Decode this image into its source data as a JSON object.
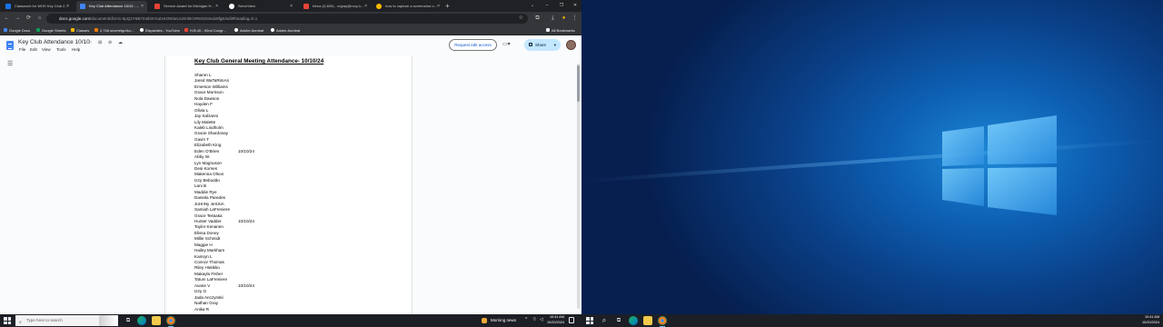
{
  "browser": {
    "tabs": [
      {
        "title": "Classwork for WHS Key Club 2...",
        "favicon_color": "#1a73e8",
        "active": false
      },
      {
        "title": "Key Club Attendance 10/10 - ...",
        "favicon_color": "#4285f4",
        "active": true
      },
      {
        "title": "Service Award for Michigan H...",
        "favicon_color": "#ea4335",
        "active": false
      },
      {
        "title": "ServeView",
        "favicon_color": "#ffffff",
        "active": false
      },
      {
        "title": "Inbox (5,609) - mgray@rocp.k...",
        "favicon_color": "#ea4335",
        "active": false
      },
      {
        "title": "how to capture a screenshot o...",
        "favicon_color": "#fbbc04",
        "active": false
      }
    ],
    "new_tab_glyph": "+",
    "window_controls": [
      "⌄",
      "–",
      "❐",
      "✕"
    ],
    "nav_glyphs": {
      "back": "←",
      "forward": "→",
      "reload": "⟳",
      "site_info": "⚙"
    },
    "url": "docs.google.com",
    "url_rest": "/document/d/1H1-5pQ4Y6B7mebmYuZxKON0eUUOnkKVRK81Nmdx8fgE/edit#heading=h.1",
    "toolbar_icons": [
      "star-icon",
      "extensions-icon",
      "download-icon",
      "profile-icon",
      "menu-icon"
    ],
    "bookmarks": [
      {
        "label": "Google Docs",
        "color": "#4285f4"
      },
      {
        "label": "Google Sheets",
        "color": "#0f9d58"
      },
      {
        "label": "Classes",
        "color": "#fbbc04"
      },
      {
        "label": "2,746 sovereign/ku...",
        "color": "#f57c00"
      },
      {
        "label": "Elsparales - YouTube",
        "color": "#ffffff"
      },
      {
        "label": "H.B.40 - 92nd Congr...",
        "color": "#ea4335"
      },
      {
        "label": "Adobe Acrobat",
        "color": "#ffffff"
      },
      {
        "label": "Adobe Acrobat",
        "color": "#ffffff"
      }
    ],
    "all_bookmarks": "All Bookmarks"
  },
  "doc": {
    "title": "Key Club Attendance 10/10",
    "menu": [
      "File",
      "Edit",
      "View",
      "Tools",
      "Help"
    ],
    "request_edit_label": "Request edit access",
    "share_label": "Share",
    "heading": "Key Club General Meeting Attendance- 10/10/24",
    "attendees": [
      {
        "name": "Sharon L",
        "date": ""
      },
      {
        "name": "Jared WaTaRimAn",
        "date": ""
      },
      {
        "name": "Emerson Williams",
        "date": ""
      },
      {
        "name": "Grace Morrison",
        "date": ""
      },
      {
        "name": "Nola Dawson",
        "date": ""
      },
      {
        "name": "Hayden F",
        "date": ""
      },
      {
        "name": "Olivia L",
        "date": ""
      },
      {
        "name": "Jay Salzanni",
        "date": ""
      },
      {
        "name": "Lily Malette",
        "date": ""
      },
      {
        "name": "Kaleb Lindholm",
        "date": ""
      },
      {
        "name": "Gracie Shardonay",
        "date": ""
      },
      {
        "name": "Gavin T",
        "date": ""
      },
      {
        "name": "Elizabeth King",
        "date": ""
      },
      {
        "name": "Eden O'Brien",
        "date": "10/10/24"
      },
      {
        "name": "Abby W.",
        "date": ""
      },
      {
        "name": "Lyn Magnuson",
        "date": ""
      },
      {
        "name": "Desi Kornes",
        "date": ""
      },
      {
        "name": "Makenna Olson",
        "date": ""
      },
      {
        "name": "Izzy Beboddo",
        "date": ""
      },
      {
        "name": "Lani B",
        "date": ""
      },
      {
        "name": "Maddie Rye",
        "date": ""
      },
      {
        "name": "Daniela Paredes",
        "date": ""
      },
      {
        "name": "JoHnNy JeSSiA",
        "date": ""
      },
      {
        "name": "Samiah LaFreniere",
        "date": ""
      },
      {
        "name": "Grace Tessaka",
        "date": ""
      },
      {
        "name": "Hunter Vadder",
        "date": "10/10/24"
      },
      {
        "name": "Taylor Kenanen",
        "date": ""
      },
      {
        "name": "Elissa Doney",
        "date": ""
      },
      {
        "name": "Millie Schmidt",
        "date": ""
      },
      {
        "name": "Maggie H",
        "date": ""
      },
      {
        "name": "Hailey Markham",
        "date": ""
      },
      {
        "name": "Kamryn L",
        "date": ""
      },
      {
        "name": "Connor Thomas",
        "date": ""
      },
      {
        "name": "Riley Hietikko",
        "date": ""
      },
      {
        "name": "Makayla Fisher",
        "date": ""
      },
      {
        "name": "Tatum LaFreniere",
        "date": ""
      },
      {
        "name": "Avarie V",
        "date": "10/10/24"
      },
      {
        "name": "Izzy G",
        "date": ""
      },
      {
        "name": "Jada Anczynski",
        "date": ""
      },
      {
        "name": "Nathan Gray",
        "date": ""
      },
      {
        "name": "Anika R",
        "date": ""
      }
    ]
  },
  "taskbar_left": {
    "search_placeholder": "Type here to search",
    "weather": "Morning news",
    "time": "10:41 AM",
    "date": "10/20/2024"
  },
  "taskbar_right": {
    "time": "10:41 AM",
    "date": "10/20/2024"
  }
}
